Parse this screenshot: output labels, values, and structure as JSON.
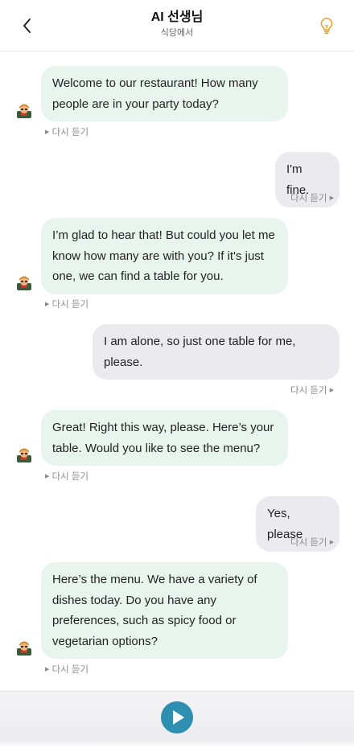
{
  "header": {
    "title": "AI 선생님",
    "subtitle": "식당에서"
  },
  "replay_label": "다시 듣기",
  "messages": [
    {
      "role": "bot",
      "text": "Welcome to our restaurant! How many people are in your party today?"
    },
    {
      "role": "user",
      "text": "I'm fine."
    },
    {
      "role": "bot",
      "text": "I’m glad to hear that! But could you let me know how many are with you? If it's just one, we can find a table for you."
    },
    {
      "role": "user",
      "text": "I am alone, so just one table for me, please."
    },
    {
      "role": "bot",
      "text": "Great! Right this way, please. Here’s your table. Would you like to see the menu?"
    },
    {
      "role": "user",
      "text": "Yes, please"
    },
    {
      "role": "bot",
      "text": "Here’s the menu. We have a variety of dishes today. Do you have any preferences, such as spicy food or vegetarian options?"
    }
  ],
  "icons": {
    "back": "chevron-left-icon",
    "hint": "lightbulb-icon",
    "avatar": "teacher-avatar-icon",
    "play": "play-icon"
  },
  "colors": {
    "bot_bubble": "#e8f5ef",
    "user_bubble": "#ebebef",
    "accent": "#f0a020",
    "play_button": "#2f8fb0"
  }
}
